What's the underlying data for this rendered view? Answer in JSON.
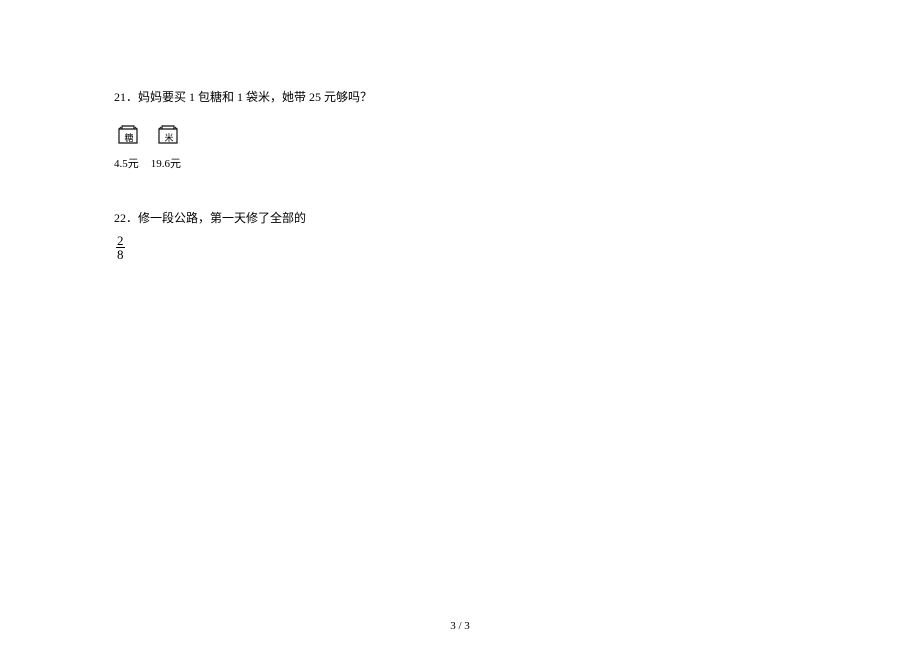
{
  "q21": {
    "number": "21．",
    "text": "妈妈要买 1 包糖和 1 袋米，她带 25 元够吗？",
    "items": [
      {
        "label": "糖",
        "price": "4.5元"
      },
      {
        "label": "米",
        "price": "19.6元"
      }
    ]
  },
  "q22": {
    "number": "22．",
    "text": "修一段公路，第一天修了全部的",
    "fraction": {
      "numerator": "2",
      "denominator": "8"
    }
  },
  "footer": "3 / 3"
}
